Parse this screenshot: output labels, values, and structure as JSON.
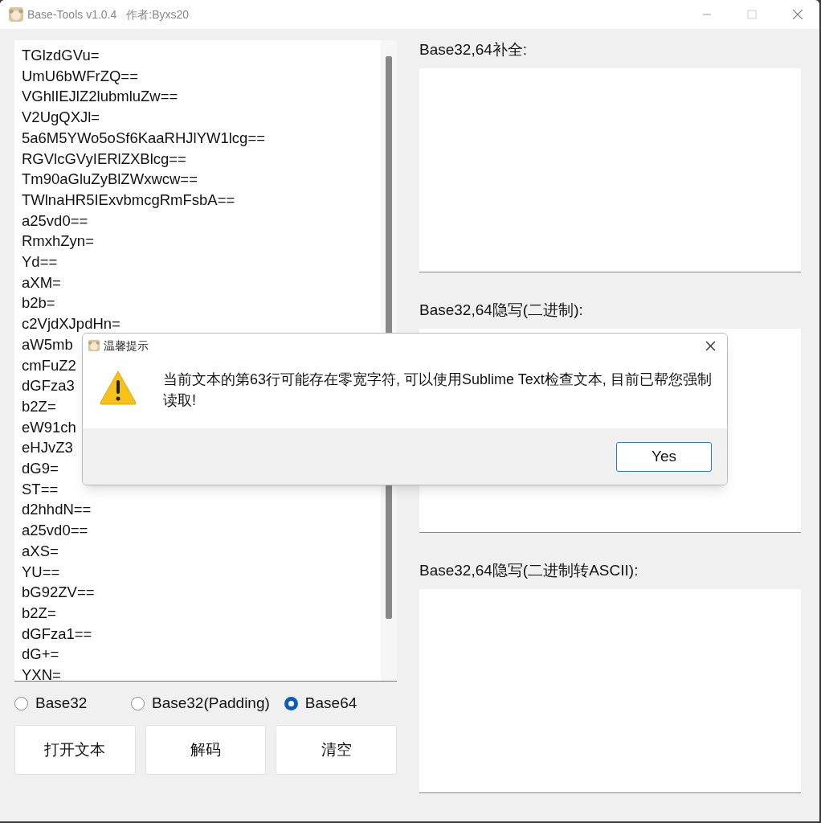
{
  "window": {
    "title": "Base-Tools v1.0.4",
    "author": "作者:Byxs20"
  },
  "input_text": {
    "lines": [
      "TGlzdGVu=",
      "UmU6bWFrZQ==",
      "VGhlIEJlZ2lubmluZw==",
      "V2UgQXJl=",
      "5a6M5YWo5oSf6KaaRHJlYW1lcg==",
      "RGVlcGVyIERlZXBlcg==",
      "Tm90aGluZyBlZWxwcw==",
      "TWlnaHR5IExvbmcgRmFsbA==",
      "a25vd0==",
      "RmxhZyn=",
      "Yd==",
      "aXM=",
      "b2b=",
      "c2VjdXJpdHn=",
      "aW5mb",
      "cmFuZ2",
      "dGFza3",
      "b2Z=",
      "eW91ch",
      "eHJvZ3",
      "dG9=",
      "ST==",
      "d2hhdN==",
      "a25vd0==",
      "aXS=",
      "YU==",
      "bG92ZV==",
      "b2Z=",
      "dGFza1==",
      "dG+=",
      "YXN="
    ]
  },
  "encoding_options": [
    {
      "label": "Base32",
      "selected": false
    },
    {
      "label": "Base32(Padding)",
      "selected": false
    },
    {
      "label": "Base64",
      "selected": true
    }
  ],
  "buttons": [
    "打开文本",
    "解码",
    "清空"
  ],
  "output_panels": [
    {
      "label": "Base32,64补全:"
    },
    {
      "label": "Base32,64隐写(二进制):"
    },
    {
      "label": "Base32,64隐写(二进制转ASCII):"
    }
  ],
  "dialog": {
    "title": "温馨提示",
    "message": "当前文本的第63行可能存在零宽字符, 可以使用Sublime Text检查文本, 目前已帮您强制读取!",
    "button": "Yes"
  }
}
